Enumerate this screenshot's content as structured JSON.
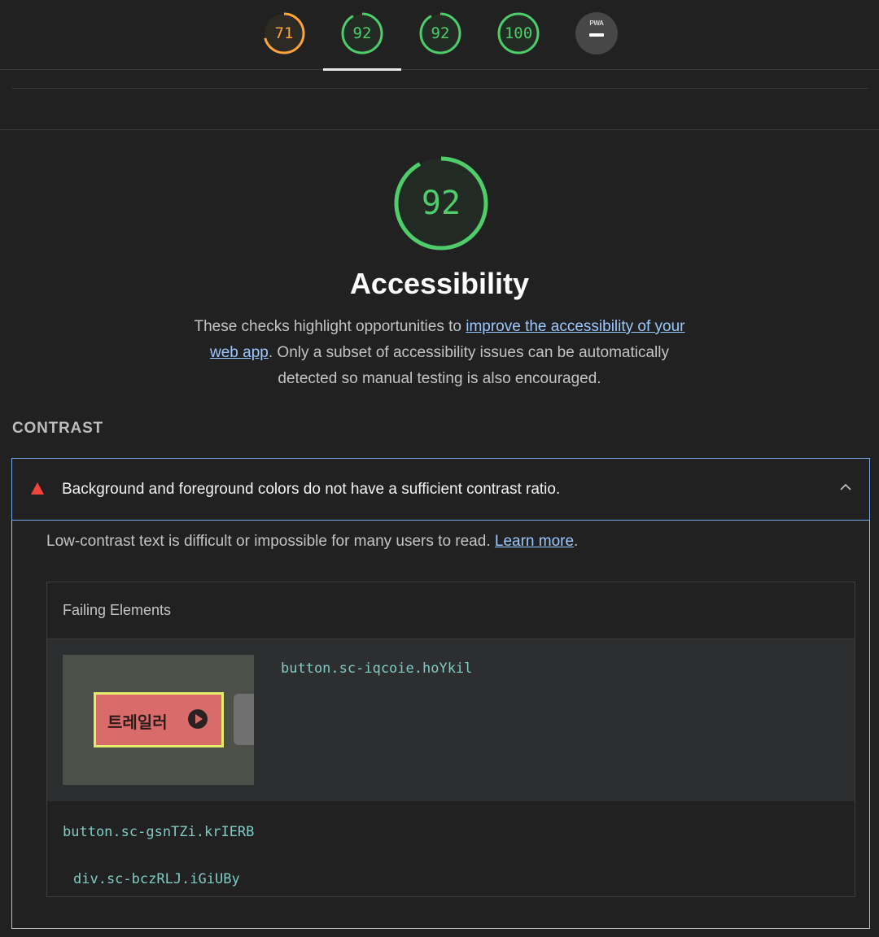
{
  "score_tabs": [
    {
      "label": "71",
      "color": "#ffa43a",
      "score": 71
    },
    {
      "label": "92",
      "color": "#4fcd6a",
      "score": 92
    },
    {
      "label": "92",
      "color": "#4fcd6a",
      "score": 92
    },
    {
      "label": "100",
      "color": "#4fcd6a",
      "score": 100
    },
    {
      "label": "PWA"
    }
  ],
  "category": {
    "score": "92",
    "score_fraction": 0.92,
    "title": "Accessibility",
    "desc_before": "These checks highlight opportunities to ",
    "desc_link": "improve the accessibility of your web app",
    "desc_after": ". Only a subset of accessibility issues can be automatically detected so manual testing is also encouraged."
  },
  "group": {
    "title": "CONTRAST"
  },
  "audit": {
    "title": "Background and foreground colors do not have a sufficient contrast ratio.",
    "desc_before": "Low-contrast text is difficult or impossible for many users to read. ",
    "desc_link": "Learn more",
    "desc_after": ".",
    "failing_header": "Failing Elements",
    "element": {
      "selector": "button.sc-iqcoie.hoYkil",
      "thumbnail_text": "트레일러",
      "path": [
        "button.sc-gsnTZi.krIERB",
        "div.sc-bczRLJ.iGiUBy"
      ]
    }
  },
  "colors": {
    "pass": "#4fcd6a",
    "average": "#ffa43a",
    "fail": "#f4433a",
    "link": "#9cc7ff",
    "code": "#80cbc4",
    "focus_border": "#7ba9e8"
  }
}
